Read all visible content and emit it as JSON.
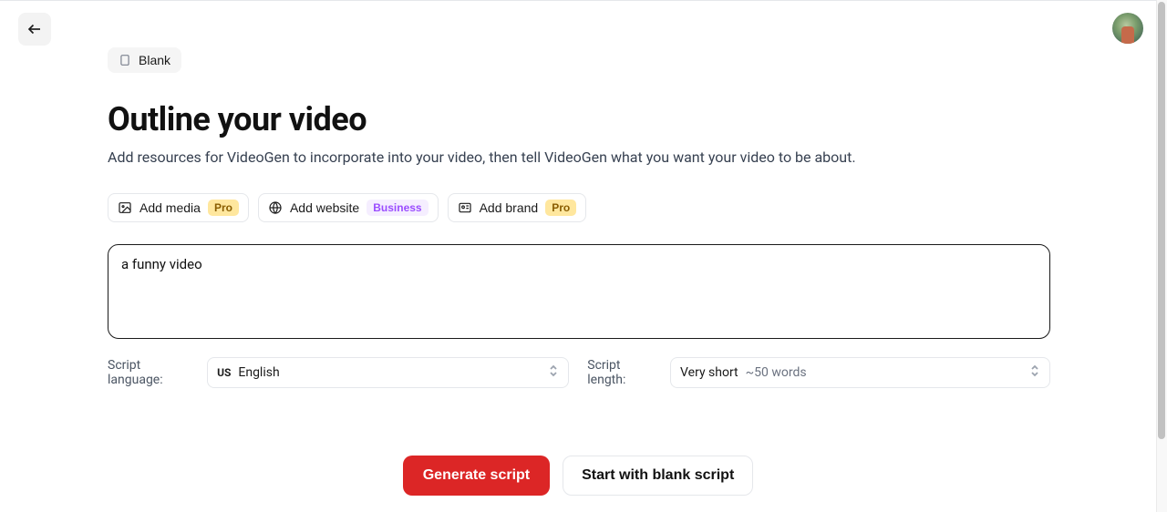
{
  "header": {
    "blank_pill": "Blank"
  },
  "page": {
    "title": "Outline your video",
    "subtitle": "Add resources for VideoGen to incorporate into your video, then tell VideoGen what you want your video to be about."
  },
  "resources": {
    "add_media": {
      "label": "Add media",
      "badge": "Pro"
    },
    "add_website": {
      "label": "Add website",
      "badge": "Business"
    },
    "add_brand": {
      "label": "Add brand",
      "badge": "Pro"
    }
  },
  "prompt": {
    "value": "a funny video"
  },
  "options": {
    "language": {
      "label": "Script language:",
      "flag_code": "US",
      "value": "English"
    },
    "length": {
      "label": "Script length:",
      "value": "Very short",
      "detail": "~50 words"
    }
  },
  "cta": {
    "primary": "Generate script",
    "secondary": "Start with blank script"
  }
}
